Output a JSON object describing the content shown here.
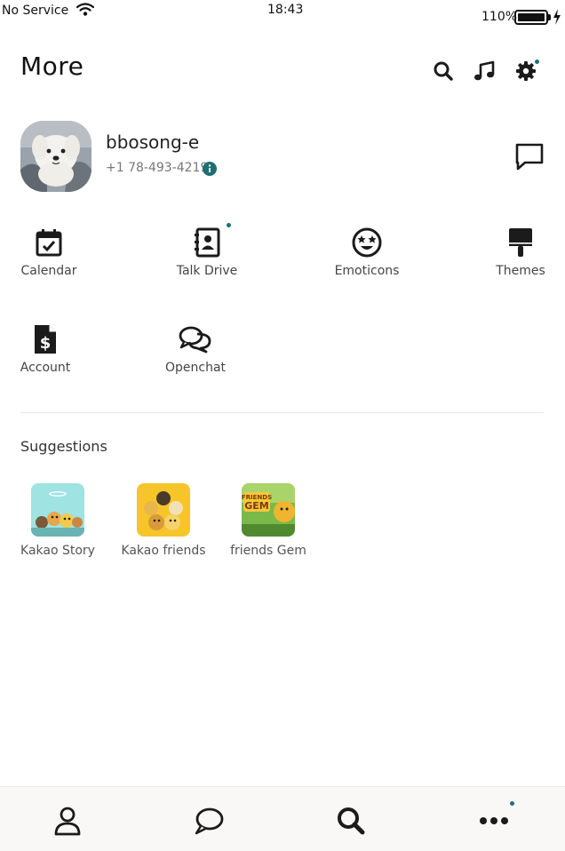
{
  "status_bar": {
    "carrier": "No Service",
    "time": "18:43",
    "battery_percent": "110%"
  },
  "header": {
    "title": "More",
    "icons": [
      "search-icon",
      "music-icon",
      "gear-icon"
    ]
  },
  "profile": {
    "name": "bbosong-e",
    "phone": "+1 78-493-4219"
  },
  "shortcuts": [
    {
      "label": "Calendar",
      "icon": "calendar-icon"
    },
    {
      "label": "Talk Drive",
      "icon": "contacts-book-icon"
    },
    {
      "label": "Emoticons",
      "icon": "star-eyes-emoji-icon"
    },
    {
      "label": "Themes",
      "icon": "paint-brush-icon"
    },
    {
      "label": "Account",
      "icon": "invoice-dollar-icon"
    },
    {
      "label": "Openchat",
      "icon": "speech-bubbles-icon"
    }
  ],
  "suggestions": {
    "title": "Suggestions",
    "items": [
      {
        "label": "Kakao Story"
      },
      {
        "label": "Kakao friends"
      },
      {
        "label": "friends Gem"
      }
    ]
  },
  "tabbar": {
    "tabs": [
      "person-icon",
      "chat-bubble-icon",
      "search-icon",
      "more-dots-icon"
    ],
    "active": "more-dots-icon"
  },
  "colors": {
    "accent_dot": "#1e6f72",
    "icon": "#222222",
    "tabbar_bg": "#faf8f7"
  }
}
